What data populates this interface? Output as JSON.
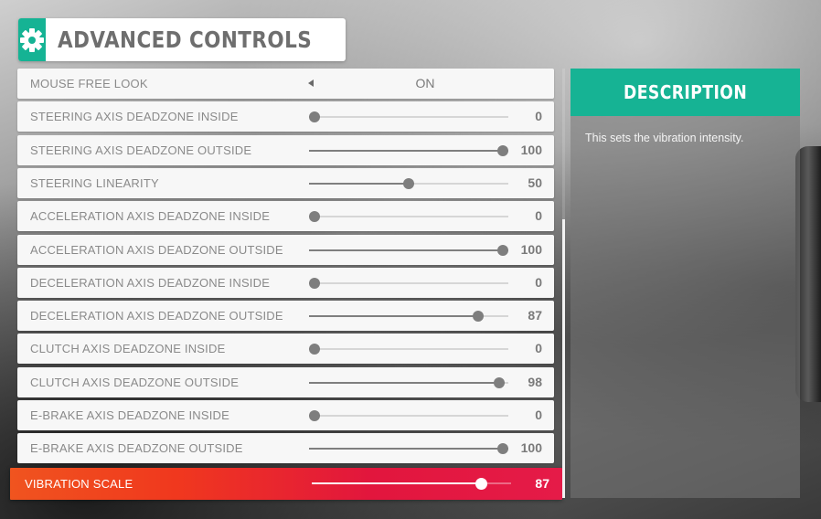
{
  "header": {
    "title": "ADVANCED CONTROLS",
    "icon": "gear-icon"
  },
  "settings": [
    {
      "label": "MOUSE FREE LOOK",
      "type": "toggle",
      "value": "ON"
    },
    {
      "label": "STEERING AXIS DEADZONE INSIDE",
      "type": "slider",
      "value": "0"
    },
    {
      "label": "STEERING AXIS DEADZONE OUTSIDE",
      "type": "slider",
      "value": "100"
    },
    {
      "label": "STEERING LINEARITY",
      "type": "slider",
      "value": "50"
    },
    {
      "label": "ACCELERATION AXIS DEADZONE INSIDE",
      "type": "slider",
      "value": "0"
    },
    {
      "label": "ACCELERATION AXIS DEADZONE OUTSIDE",
      "type": "slider",
      "value": "100"
    },
    {
      "label": "DECELERATION AXIS DEADZONE INSIDE",
      "type": "slider",
      "value": "0"
    },
    {
      "label": "DECELERATION AXIS DEADZONE OUTSIDE",
      "type": "slider",
      "value": "87"
    },
    {
      "label": "CLUTCH AXIS DEADZONE INSIDE",
      "type": "slider",
      "value": "0"
    },
    {
      "label": "CLUTCH AXIS DEADZONE OUTSIDE",
      "type": "slider",
      "value": "98"
    },
    {
      "label": "E-BRAKE AXIS DEADZONE INSIDE",
      "type": "slider",
      "value": "0"
    },
    {
      "label": "E-BRAKE AXIS DEADZONE OUTSIDE",
      "type": "slider",
      "value": "100"
    },
    {
      "label": "VIBRATION SCALE",
      "type": "slider",
      "value": "87",
      "selected": true
    }
  ],
  "description": {
    "title": "DESCRIPTION",
    "text": "This sets the vibration intensity."
  },
  "colors": {
    "accent": "#16b394",
    "selected_start": "#f0541f",
    "selected_end": "#e51b48"
  }
}
